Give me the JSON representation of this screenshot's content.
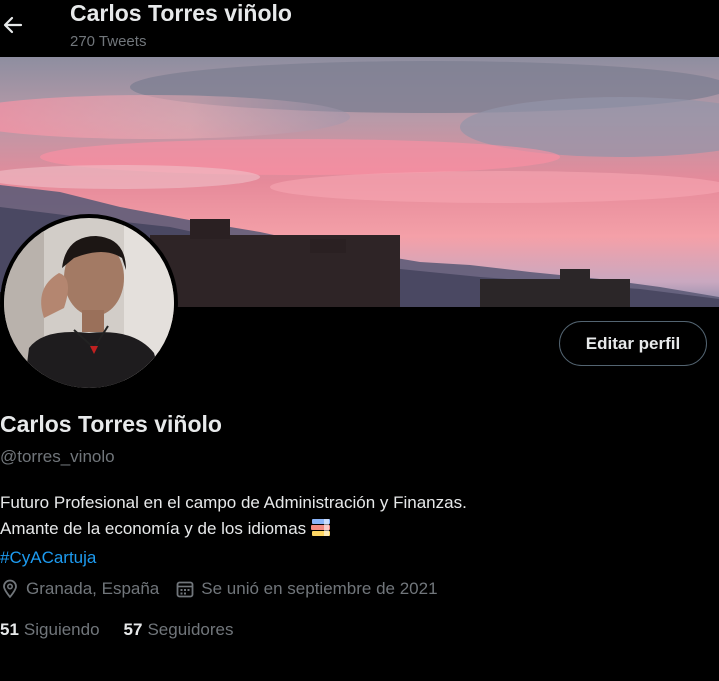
{
  "header": {
    "title": "Carlos Torres viñolo",
    "tweet_count": "270 Tweets"
  },
  "profile": {
    "name": "Carlos Torres viñolo",
    "handle": "@torres_vinolo",
    "edit_label": "Editar perfil",
    "bio_line1": "Futuro Profesional en el campo de Administración y Finanzas.",
    "bio_line2": "Amante de la economía y de los idiomas",
    "hashtag": "#CyACartuja",
    "location": "Granada, España",
    "joined": "Se unió en septiembre de 2021",
    "following_count": "51",
    "following_label": "Siguiendo",
    "followers_count": "57",
    "followers_label": "Seguidores"
  },
  "icons": {
    "back": "arrow-left-icon",
    "location": "location-pin-icon",
    "calendar": "calendar-icon",
    "bio_emoji": "books-icon"
  },
  "colors": {
    "background": "#000000",
    "text": "#e7e9ea",
    "secondary_text": "#71767b",
    "link": "#1d9bf0",
    "button_border": "#536471"
  }
}
